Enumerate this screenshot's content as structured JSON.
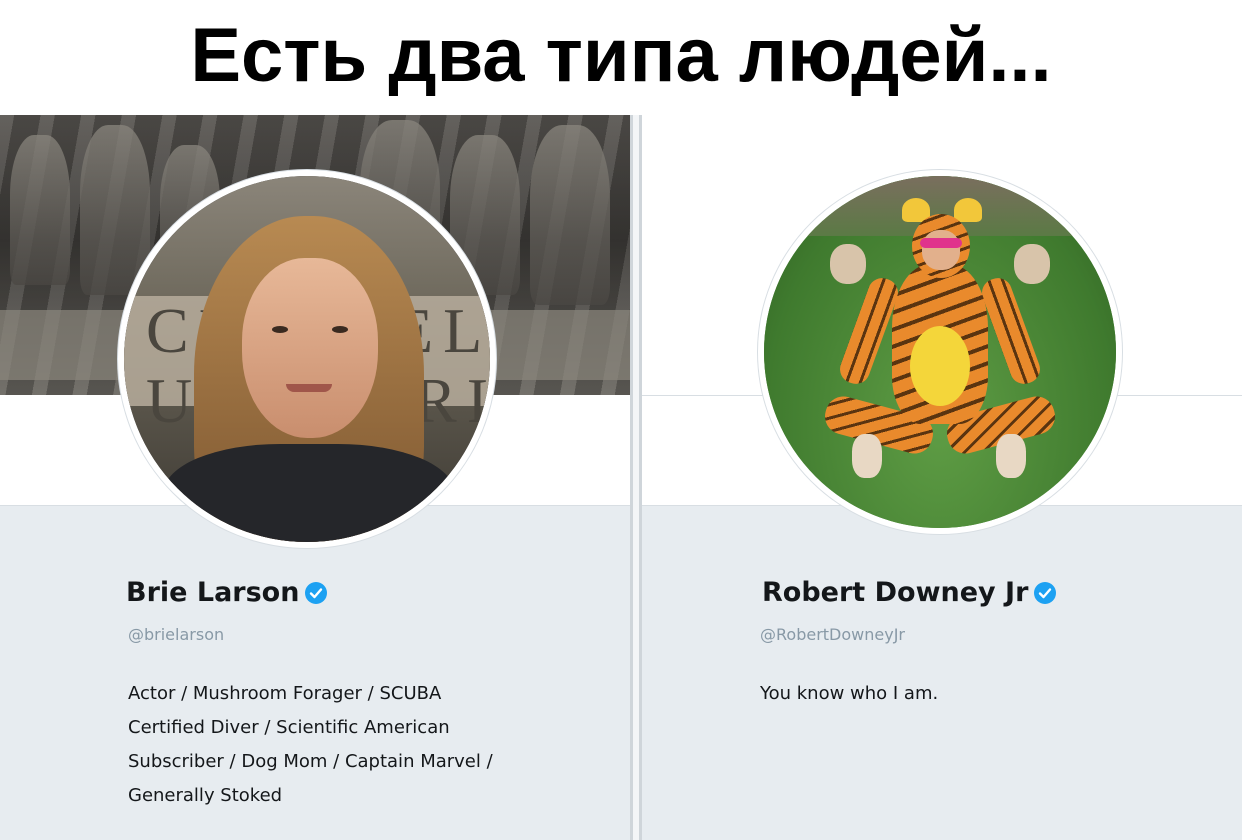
{
  "meme": {
    "title": "Есть два типа людей..."
  },
  "profiles": [
    {
      "display_name": "Brie Larson",
      "handle": "@brielarson",
      "verified": true,
      "avatar_icon": "avatar-photo",
      "header": "stone-carving-photo",
      "bio_lines": [
        "Actor / Mushroom Forager / SCUBA",
        "Certified Diver / Scientific American",
        "Subscriber / Dog Mom / Captain Marvel /",
        "Generally Stoked"
      ]
    },
    {
      "display_name": "Robert Downey Jr",
      "handle": "@RobertDowneyJr",
      "verified": true,
      "avatar_icon": "avatar-photo",
      "header": "blank",
      "bio_lines": [
        "You know who I am."
      ]
    }
  ],
  "colors": {
    "verified_blue": "#1da1f2",
    "panel_bg": "#e7ecf0",
    "handle_gray": "#8899a6",
    "text_dark": "#14171a"
  }
}
